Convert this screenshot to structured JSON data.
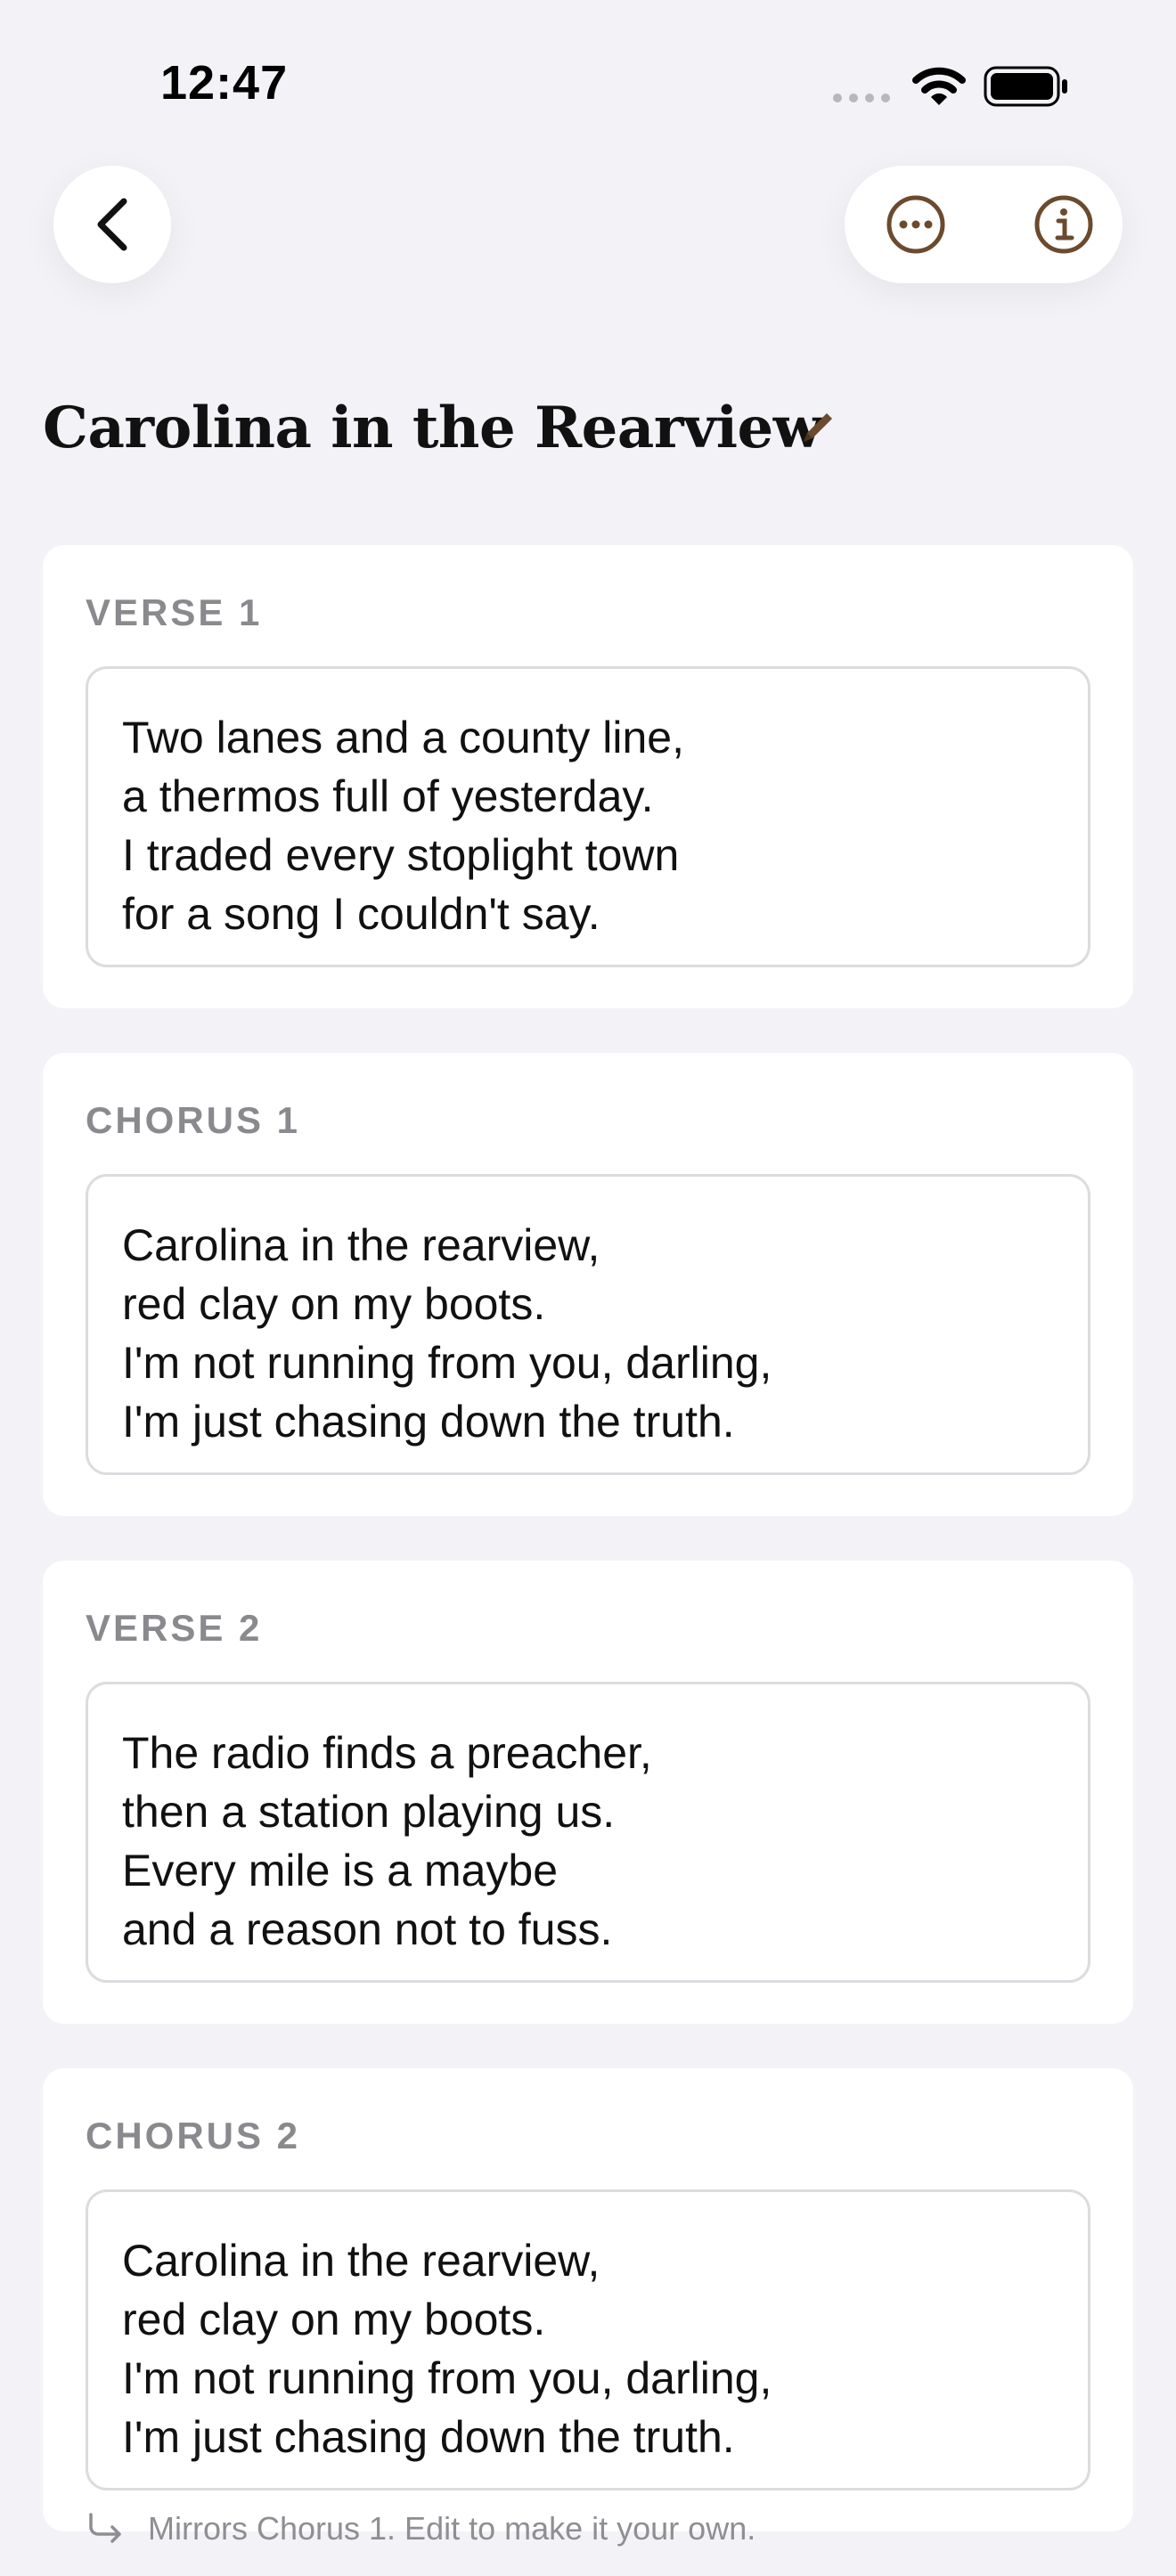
{
  "status_bar": {
    "time": "12:47"
  },
  "nav": {
    "back_icon": "chevron-left-icon",
    "more_icon": "ellipsis-circle-icon",
    "info_icon": "info-circle-icon"
  },
  "song": {
    "title": "Carolina in the Rearview",
    "edit_icon": "pencil-icon"
  },
  "sections": [
    {
      "label": "VERSE 1",
      "lines": [
        "Two lanes and a county line,",
        "a thermos full of yesterday.",
        "I traded every stoplight town",
        "for a song I couldn't say."
      ]
    },
    {
      "label": "CHORUS 1",
      "lines": [
        "Carolina in the rearview,",
        "red clay on my boots.",
        "I'm not running from you, darling,",
        "I'm just chasing down the truth."
      ]
    },
    {
      "label": "VERSE 2",
      "lines": [
        "The radio finds a preacher,",
        "then a station playing us.",
        "Every mile is a maybe",
        "and a reason not to fuss."
      ]
    },
    {
      "label": "CHORUS 2",
      "lines": [
        "Carolina in the rearview,",
        "red clay on my boots.",
        "I'm not running from you, darling,",
        "I'm just chasing down the truth."
      ]
    }
  ],
  "mirror_note": {
    "text": "Mirrors Chorus 1. Edit to make it your own.",
    "icon": "return-arrow-icon"
  },
  "colors": {
    "accent": "#6b4a2e",
    "background": "#f2f2f7",
    "card": "#ffffff",
    "label": "#8a8a8e"
  }
}
